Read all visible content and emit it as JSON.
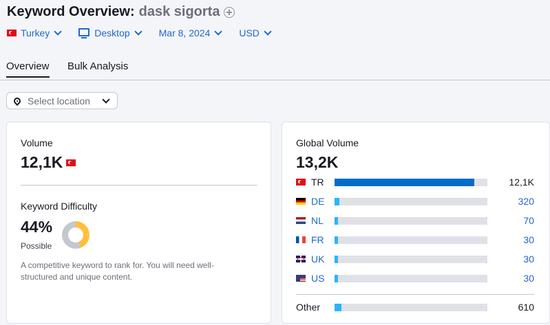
{
  "header": {
    "title": "Keyword Overview:",
    "keyword": "dask sigorta"
  },
  "filters": {
    "country": "Turkey",
    "device": "Desktop",
    "date": "Mar 8, 2024",
    "currency": "USD"
  },
  "tabs": [
    {
      "label": "Overview"
    },
    {
      "label": "Bulk Analysis"
    }
  ],
  "location_select": {
    "placeholder": "Select location"
  },
  "volume_card": {
    "volume_label": "Volume",
    "volume_value": "12,1K",
    "kd_label": "Keyword Difficulty",
    "kd_value": "44%",
    "kd_percent": 44,
    "kd_status": "Possible",
    "kd_description": "A competitive keyword to rank for. You will need well-structured and unique content."
  },
  "global_card": {
    "label": "Global Volume",
    "value": "13,2K",
    "rows": [
      {
        "code": "TR",
        "value": "12,1K",
        "fill": 0.915,
        "color": "#006dca",
        "flag": "turkey-flag-icon"
      },
      {
        "code": "DE",
        "value": "320",
        "fill": 0.03,
        "color": "#2bb3ff",
        "flag": "germany-flag-icon"
      },
      {
        "code": "NL",
        "value": "70",
        "fill": 0.012,
        "color": "#2bb3ff",
        "flag": "netherlands-flag-icon"
      },
      {
        "code": "FR",
        "value": "30",
        "fill": 0.012,
        "color": "#2bb3ff",
        "flag": "france-flag-icon"
      },
      {
        "code": "UK",
        "value": "30",
        "fill": 0.012,
        "color": "#2bb3ff",
        "flag": "uk-flag-icon"
      },
      {
        "code": "US",
        "value": "30",
        "fill": 0.012,
        "color": "#2bb3ff",
        "flag": "usa-flag-icon"
      }
    ],
    "other": {
      "label": "Other",
      "value": "610",
      "fill": 0.045,
      "color": "#2bb3ff"
    }
  },
  "colors": {
    "accent": "#1e68c9",
    "kd_fill": "#ffbe3d"
  }
}
